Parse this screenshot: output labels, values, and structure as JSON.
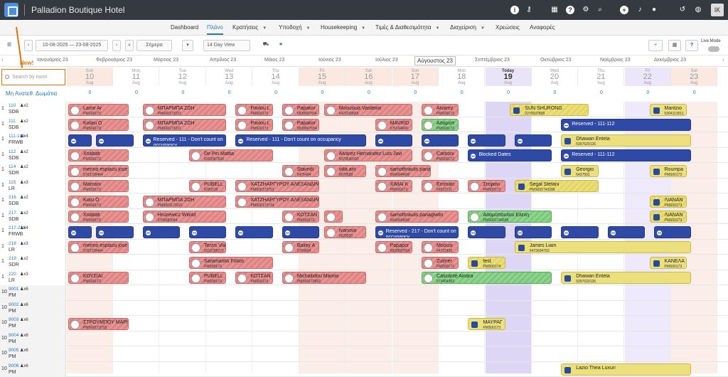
{
  "topbar": {
    "title": "Palladion Boutique Hotel",
    "avatar": "IK",
    "icons": [
      "info-icon",
      "key-icon",
      "grid-icon",
      "help-icon",
      "search-icon",
      "plus-icon",
      "bell-icon",
      "user-icon",
      "history-icon",
      "globe-icon"
    ]
  },
  "nav": {
    "items": [
      "Dashboard",
      "Πλάνο",
      "Κρατήσεις",
      "Υποδοχή",
      "Housekeeping",
      "Τιμές & Διαθεσιμότητα",
      "Διαχείριση",
      "Χρεώσεις",
      "Αναφορές"
    ],
    "active": "Πλάνο"
  },
  "toolbar": {
    "date_range": "10-08-2025 — 23-08-2025",
    "today_label": "Σήμερα",
    "view_label": "14 Day View",
    "live_mode": "Live Mode"
  },
  "new_label": "New!",
  "months": [
    "Ιανουάριος 23",
    "Φεβρουάριος 23",
    "Μάρτιος 23",
    "Απρίλιος 23",
    "Μάιος 23",
    "Ιούνιος 23",
    "Ιούλιος 23",
    "Αύγουστος 23",
    "Σεπτέμβριος 23",
    "Οκτώβριος 23",
    "Νοέμβριος 23",
    "Δεκέμβριος 23"
  ],
  "search_placeholder": "Search by room",
  "unassigned_label": "Μη Ανατεθ. Δωμάτια",
  "days": [
    {
      "wd": "Sun",
      "dn": "10",
      "mo": "Aug",
      "kind": "wkend"
    },
    {
      "wd": "Mon",
      "dn": "11",
      "mo": "Aug",
      "kind": ""
    },
    {
      "wd": "Tue",
      "dn": "12",
      "mo": "Aug",
      "kind": ""
    },
    {
      "wd": "Wed",
      "dn": "13",
      "mo": "Aug",
      "kind": ""
    },
    {
      "wd": "Thu",
      "dn": "14",
      "mo": "Aug",
      "kind": ""
    },
    {
      "wd": "Fri",
      "dn": "15",
      "mo": "Aug",
      "kind": "wkend"
    },
    {
      "wd": "Sat",
      "dn": "16",
      "mo": "Aug",
      "kind": "wkend"
    },
    {
      "wd": "Sun",
      "dn": "17",
      "mo": "Aug",
      "kind": "wkend"
    },
    {
      "wd": "Mon",
      "dn": "18",
      "mo": "Aug",
      "kind": ""
    },
    {
      "wd": "Today",
      "dn": "19",
      "mo": "Aug",
      "kind": "today"
    },
    {
      "wd": "Wed",
      "dn": "20",
      "mo": "Aug",
      "kind": ""
    },
    {
      "wd": "Thu",
      "dn": "21",
      "mo": "Aug",
      "kind": ""
    },
    {
      "wd": "Fri",
      "dn": "22",
      "mo": "Aug",
      "kind": "lilac"
    },
    {
      "wd": "Sat",
      "dn": "23",
      "mo": "Aug",
      "kind": "wkend"
    }
  ],
  "unassigned_counts": [
    "0",
    "0",
    "0",
    "0",
    "0",
    "0",
    "0",
    "0",
    "0",
    "0",
    "0",
    "0",
    "0",
    "0"
  ],
  "rooms": [
    {
      "c": "1",
      "n": "110",
      "cap": "2",
      "t": "SDB"
    },
    {
      "c": "1",
      "n": "111",
      "cap": "2",
      "t": "SDB"
    },
    {
      "c": "1",
      "n": "111-113",
      "cap": "4",
      "t": "FRWB"
    },
    {
      "c": "1",
      "n": "112",
      "cap": "2",
      "t": "SDB"
    },
    {
      "c": "1",
      "n": "114",
      "cap": "2",
      "t": "SDR"
    },
    {
      "c": "1",
      "n": "115",
      "cap": "3",
      "t": "LR"
    },
    {
      "c": "1",
      "n": "216",
      "cap": "2",
      "t": "SDB"
    },
    {
      "c": "1",
      "n": "217",
      "cap": "2",
      "t": "SDB"
    },
    {
      "c": "1",
      "n": "217-218",
      "cap": "4",
      "t": "FRWB"
    },
    {
      "c": "1",
      "n": "218",
      "cap": "3",
      "t": "LR"
    },
    {
      "c": "1",
      "n": "219",
      "cap": "2",
      "t": "SDR"
    },
    {
      "c": "1",
      "n": "220",
      "cap": "3",
      "t": "LR"
    },
    {
      "c": "10",
      "n": "9001",
      "cap": "6",
      "t": "PM"
    },
    {
      "c": "10",
      "n": "9002",
      "cap": "6",
      "t": "PM"
    },
    {
      "c": "10",
      "n": "9003",
      "cap": "6",
      "t": "PM"
    },
    {
      "c": "10",
      "n": "9004",
      "cap": "6",
      "t": "PM"
    },
    {
      "c": "10",
      "n": "9005",
      "cap": "6",
      "t": "PM"
    },
    {
      "c": "10",
      "n": "9006",
      "cap": "6",
      "t": "PM"
    }
  ],
  "bookings": [
    {
      "r": 0,
      "s": 0,
      "e": 1.3,
      "cls": "red",
      "nm": "Lame Ar",
      "sb": "PMS00173"
    },
    {
      "r": 0,
      "s": 1.6,
      "e": 3.4,
      "cls": "red",
      "nm": "ΜΠΑΡΜΠΑ ΖΩΗ",
      "sb": "PMS00173221"
    },
    {
      "r": 0,
      "s": 3.6,
      "e": 4.4,
      "cls": "red",
      "nm": "Pavlou L",
      "sb": "PMS00173"
    },
    {
      "r": 0,
      "s": 4.6,
      "e": 5.4,
      "cls": "red",
      "nm": "Papakor",
      "sb": "5839897654"
    },
    {
      "r": 0,
      "s": 5.5,
      "e": 7.4,
      "cls": "red",
      "nm": "Moousiua Vasileios",
      "sb": "5472243665"
    },
    {
      "r": 0,
      "s": 7.6,
      "e": 8.4,
      "cls": "red",
      "nm": "Alvarez",
      "sb": "PMS00173"
    },
    {
      "r": 0,
      "s": 9.5,
      "e": 11.2,
      "cls": "yellow",
      "nm": "SUN SHURONG",
      "sb": "2270937858"
    },
    {
      "r": 0,
      "s": 12.5,
      "e": 13.3,
      "cls": "yfill",
      "nm": "Mantzio",
      "sb": "5304113011"
    },
    {
      "r": 1,
      "s": 0,
      "e": 1.3,
      "cls": "red",
      "nm": "Kolasi O",
      "sb": "PMS00173"
    },
    {
      "r": 1,
      "s": 1.6,
      "e": 3.4,
      "cls": "red",
      "nm": "ΜΠΑΡΜΠΑ ΖΩΗ",
      "sb": "PMS00173221"
    },
    {
      "r": 1,
      "s": 3.6,
      "e": 4.4,
      "cls": "red",
      "nm": "Pavlou L",
      "sb": "PMS00173"
    },
    {
      "r": 1,
      "s": 4.6,
      "e": 5.4,
      "cls": "red",
      "nm": "Papakor",
      "sb": "5839897654"
    },
    {
      "r": 1,
      "s": 6.6,
      "e": 7.4,
      "cls": "red",
      "nm": "MAVRID",
      "sb": "575194849"
    },
    {
      "r": 1,
      "s": 7.6,
      "e": 8.4,
      "cls": "green",
      "nm": "Αδαμοπ",
      "sb": "PMS00173"
    },
    {
      "r": 1,
      "s": 10.6,
      "e": 13.4,
      "cls": "blue",
      "nm": "Reserved - 111-112",
      "sb": ""
    },
    {
      "r": 2,
      "s": 0,
      "e": 0.5,
      "cls": "blue",
      "nm": "",
      "sb": ""
    },
    {
      "r": 2,
      "s": 0.6,
      "e": 1.4,
      "cls": "blue",
      "nm": "",
      "sb": ""
    },
    {
      "r": 2,
      "s": 1.6,
      "e": 3.4,
      "cls": "blue",
      "nm": "Reserved - 111 - Don't count on occupancy",
      "sb": ""
    },
    {
      "r": 2,
      "s": 3.6,
      "e": 6.4,
      "cls": "blue",
      "nm": "Reserved - 111 - Don't count on occupancy",
      "sb": ""
    },
    {
      "r": 2,
      "s": 6.6,
      "e": 7.4,
      "cls": "blue",
      "nm": "",
      "sb": ""
    },
    {
      "r": 2,
      "s": 7.6,
      "e": 8.4,
      "cls": "blue",
      "nm": "",
      "sb": ""
    },
    {
      "r": 2,
      "s": 8.6,
      "e": 9.4,
      "cls": "blue",
      "nm": "",
      "sb": ""
    },
    {
      "r": 2,
      "s": 9.6,
      "e": 10.4,
      "cls": "blue",
      "nm": "",
      "sb": ""
    },
    {
      "r": 2,
      "s": 10.6,
      "e": 13.4,
      "cls": "yfill",
      "nm": "Dhawan Entela",
      "sb": "5097620126"
    },
    {
      "r": 3,
      "s": 0,
      "e": 1.3,
      "cls": "red",
      "nm": "Xnabafi",
      "sb": "PMS00173"
    },
    {
      "r": 3,
      "s": 2.6,
      "e": 4.4,
      "cls": "red",
      "nm": "De Pin Mattia",
      "sb": "5352087934"
    },
    {
      "r": 3,
      "s": 5.5,
      "e": 7.4,
      "cls": "red",
      "nm": "Alvarez Hernandez Luis Javi",
      "sb": "5379640390"
    },
    {
      "r": 3,
      "s": 7.6,
      "e": 8.4,
      "cls": "red",
      "nm": "Carboni",
      "sb": "PMS00173"
    },
    {
      "r": 3,
      "s": 8.6,
      "e": 10.4,
      "cls": "blue",
      "nm": "Blocked Dates",
      "sb": ""
    },
    {
      "r": 3,
      "s": 10.6,
      "e": 13.4,
      "cls": "blue",
      "nm": "Reserved - 111-112",
      "sb": ""
    },
    {
      "r": 4,
      "s": 0,
      "e": 1.3,
      "cls": "red",
      "nm": "merino espiazu jose manuel",
      "sb": "5763739464"
    },
    {
      "r": 4,
      "s": 4.6,
      "e": 5.4,
      "cls": "red",
      "nm": "Stavridi",
      "sb": "5475494"
    },
    {
      "r": 4,
      "s": 5.5,
      "e": 6.4,
      "cls": "red",
      "nm": "villa ant",
      "sb": "5679599"
    },
    {
      "r": 4,
      "s": 6.6,
      "e": 7.8,
      "cls": "red",
      "nm": "samothraulis panagiwtis",
      "sb": "5646944690"
    },
    {
      "r": 4,
      "s": 10.6,
      "e": 11.4,
      "cls": "yfill",
      "nm": "Georgio",
      "sb": "6437591"
    },
    {
      "r": 4,
      "s": 12.5,
      "e": 13.3,
      "cls": "yfill",
      "nm": "Roumpa",
      "sb": "PMS00173"
    },
    {
      "r": 5,
      "s": 0,
      "e": 1.3,
      "cls": "red",
      "nm": "Mamani",
      "sb": "PMS00173"
    },
    {
      "r": 5,
      "s": 2.6,
      "e": 3.4,
      "cls": "red",
      "nm": "PUBELL",
      "sb": "5283139"
    },
    {
      "r": 5,
      "s": 3.6,
      "e": 5.4,
      "cls": "red",
      "nm": "ΧΑΤΖΗΑΡΓΥΡΟΥ ΑΛΕΞΑΝΔΡΑ",
      "sb": "PMS00173752"
    },
    {
      "r": 5,
      "s": 6.6,
      "e": 7.4,
      "cls": "red",
      "nm": "XIMAI K",
      "sb": "PMS00173"
    },
    {
      "r": 5,
      "s": 7.6,
      "e": 8.4,
      "cls": "red",
      "nm": "Emmatc",
      "sb": "54533711"
    },
    {
      "r": 5,
      "s": 8.6,
      "e": 9.4,
      "cls": "red",
      "nm": "Στεφανι",
      "sb": "PMS00173"
    },
    {
      "r": 5,
      "s": 9.6,
      "e": 11.4,
      "cls": "yellow",
      "nm": "Segal Stefani",
      "sb": "PMS001743286"
    },
    {
      "r": 6,
      "s": 0,
      "e": 1.3,
      "cls": "red",
      "nm": "Kiasi O",
      "sb": "PMS00173"
    },
    {
      "r": 6,
      "s": 1.6,
      "e": 3.4,
      "cls": "red",
      "nm": "ΜΠΑΡΜΠΑ ΖΩΗ",
      "sb": "PMS001173221"
    },
    {
      "r": 6,
      "s": 3.6,
      "e": 5.4,
      "cls": "red",
      "nm": "ΧΑΤΖΗΑΡΓΥΡΟΥ ΑΛΕΞΑΝΔΡΑ",
      "sb": "PMS00173734"
    },
    {
      "r": 6,
      "s": 12.5,
      "e": 13.3,
      "cls": "yellow",
      "nm": "ΛΙΑΝΑΝ",
      "sb": "PMS00173"
    },
    {
      "r": 7,
      "s": 0,
      "e": 1.3,
      "cls": "red",
      "nm": "Xnabafi",
      "sb": "PMS00173"
    },
    {
      "r": 7,
      "s": 1.6,
      "e": 3.4,
      "cls": "red",
      "nm": "Hruzewicz Witold",
      "sb": "5758382044"
    },
    {
      "r": 7,
      "s": 4.6,
      "e": 5.4,
      "cls": "red",
      "nm": "ΚΟΤΣΑΝ",
      "sb": "PMS00173"
    },
    {
      "r": 7,
      "s": 5.5,
      "e": 5.9,
      "cls": "red",
      "nm": "",
      "sb": ""
    },
    {
      "r": 7,
      "s": 6.6,
      "e": 8.4,
      "cls": "red",
      "nm": "samothraulis panagiwtis",
      "sb": "5646944690"
    },
    {
      "r": 7,
      "s": 8.6,
      "e": 10.4,
      "cls": "green",
      "nm": "Αδαμοπουλου Ελενη",
      "sb": "PMS001744595"
    },
    {
      "r": 7,
      "s": 12.5,
      "e": 13.3,
      "cls": "yellow",
      "nm": "ΛΙΑΝΑΝ",
      "sb": "PMS00173"
    },
    {
      "r": 8,
      "s": 0,
      "e": 0.5,
      "cls": "blue",
      "nm": "",
      "sb": ""
    },
    {
      "r": 8,
      "s": 0.6,
      "e": 1.4,
      "cls": "blue",
      "nm": "",
      "sb": ""
    },
    {
      "r": 8,
      "s": 1.6,
      "e": 2.4,
      "cls": "blue",
      "nm": "",
      "sb": ""
    },
    {
      "r": 8,
      "s": 2.6,
      "e": 3.4,
      "cls": "blue",
      "nm": "",
      "sb": ""
    },
    {
      "r": 8,
      "s": 3.6,
      "e": 4.4,
      "cls": "blue",
      "nm": "",
      "sb": ""
    },
    {
      "r": 8,
      "s": 4.6,
      "e": 5.4,
      "cls": "blue",
      "nm": "",
      "sb": ""
    },
    {
      "r": 8,
      "s": 5.5,
      "e": 6.4,
      "cls": "red",
      "nm": "Ivanova",
      "sb": "5629920"
    },
    {
      "r": 8,
      "s": 6.6,
      "e": 8.4,
      "cls": "blue",
      "nm": "Reserved - 217 - Don't count on occupancy",
      "sb": ""
    },
    {
      "r": 8,
      "s": 8.6,
      "e": 9.4,
      "cls": "blue",
      "nm": "",
      "sb": ""
    },
    {
      "r": 8,
      "s": 9.6,
      "e": 10.4,
      "cls": "blue",
      "nm": "",
      "sb": ""
    },
    {
      "r": 8,
      "s": 10.6,
      "e": 11.4,
      "cls": "blue",
      "nm": "",
      "sb": ""
    },
    {
      "r": 8,
      "s": 11.6,
      "e": 12.4,
      "cls": "blue",
      "nm": "",
      "sb": ""
    },
    {
      "r": 8,
      "s": 12.6,
      "e": 13.4,
      "cls": "blue",
      "nm": "",
      "sb": ""
    },
    {
      "r": 9,
      "s": 0,
      "e": 1.3,
      "cls": "red",
      "nm": "merino espiazu jose manuel",
      "sb": "5763739464"
    },
    {
      "r": 9,
      "s": 2.6,
      "e": 3.4,
      "cls": "red",
      "nm": "Terzis Vlasios",
      "sb": "6319786271"
    },
    {
      "r": 9,
      "s": 4.6,
      "e": 5.4,
      "cls": "red",
      "nm": "Bailey A",
      "sb": "5754824"
    },
    {
      "r": 9,
      "s": 6.6,
      "e": 7.4,
      "cls": "red",
      "nm": "Papapor",
      "sb": "5839897654"
    },
    {
      "r": 9,
      "s": 7.6,
      "e": 8.4,
      "cls": "red",
      "nm": "Moousi",
      "sb": "54722436"
    },
    {
      "r": 9,
      "s": 9.6,
      "e": 13.4,
      "cls": "yfill",
      "nm": "James Liam",
      "sb": "6473694763"
    },
    {
      "r": 10,
      "s": 2.6,
      "e": 4.4,
      "cls": "red",
      "nm": "Saramantis Fotios",
      "sb": "PMS00173"
    },
    {
      "r": 10,
      "s": 7.6,
      "e": 8.4,
      "cls": "red",
      "nm": "Zuimer",
      "sb": "PMS00173"
    },
    {
      "r": 10,
      "s": 8.6,
      "e": 9.4,
      "cls": "yellow",
      "nm": "test",
      "sb": "PMS00174"
    },
    {
      "r": 10,
      "s": 12.5,
      "e": 13.3,
      "cls": "yfill",
      "nm": "ΚΑΝΕΛΑ",
      "sb": "PMS00173"
    },
    {
      "r": 11,
      "s": 0,
      "e": 1.3,
      "cls": "red",
      "nm": "ΚΟΥΣΙΑΙ",
      "sb": "PMS00173"
    },
    {
      "r": 11,
      "s": 2.6,
      "e": 3.4,
      "cls": "red",
      "nm": "PUBELL",
      "sb": "PMS00173"
    },
    {
      "r": 11,
      "s": 3.6,
      "e": 4.4,
      "cls": "red",
      "nm": "ΚΟΤΣΑΝ",
      "sb": "PMS00173"
    },
    {
      "r": 11,
      "s": 4.6,
      "e": 6.4,
      "cls": "red",
      "nm": "Michailidou Marina",
      "sb": "PMS00173833"
    },
    {
      "r": 11,
      "s": 7.6,
      "e": 10.4,
      "cls": "green",
      "nm": "Cascante Ainara",
      "sb": "573404352"
    },
    {
      "r": 11,
      "s": 10.6,
      "e": 13.4,
      "cls": "yfill",
      "nm": "Dhawan Entela",
      "sb": "5097620126"
    },
    {
      "r": 14,
      "s": 0,
      "e": 1.3,
      "cls": "red",
      "nm": "ΣΤΡΟΥΜΠΟΥ ΜΑΡΙ",
      "sb": "PMS00173718"
    },
    {
      "r": 14,
      "s": 8.6,
      "e": 9.4,
      "cls": "yfill",
      "nm": "ΜΑΥΡΑΓ",
      "sb": "PMS00173"
    },
    {
      "r": 17,
      "s": 10.6,
      "e": 13.4,
      "cls": "yfill",
      "nm": "Lazio Thea Luxuri",
      "sb": ""
    }
  ]
}
